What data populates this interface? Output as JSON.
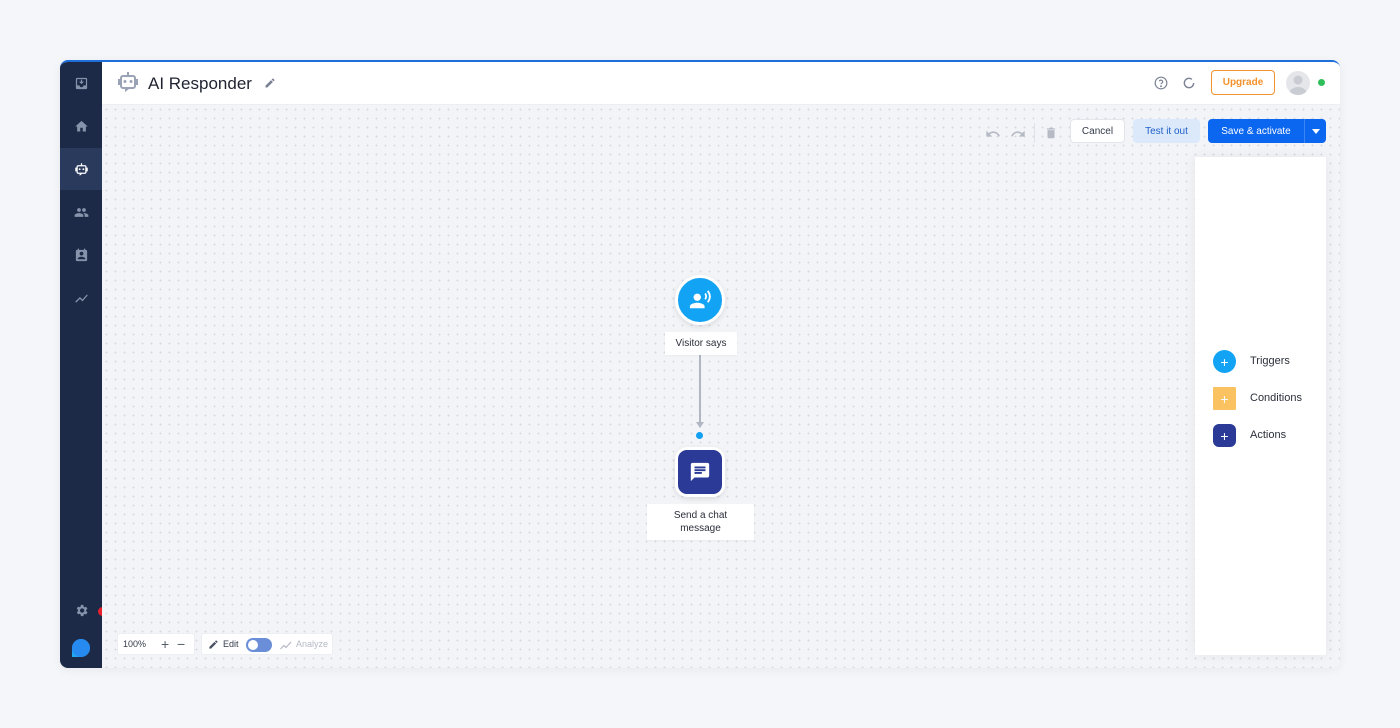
{
  "app": {
    "title": "AI Responder",
    "accent_color": "#0b66f0",
    "sidebar_color": "#1c2a47"
  },
  "sidebar": {
    "items": [
      {
        "icon": "inbox-icon",
        "active": false
      },
      {
        "icon": "home-icon",
        "active": false
      },
      {
        "icon": "bot-icon",
        "active": true
      },
      {
        "icon": "people-icon",
        "active": false
      },
      {
        "icon": "contacts-icon",
        "active": false
      },
      {
        "icon": "analytics-icon",
        "active": false
      }
    ],
    "bottom": {
      "settings_icon": "gear-icon",
      "notification": true,
      "logo_icon": "brand-logo"
    }
  },
  "header": {
    "upgrade_label": "Upgrade",
    "help_icon": "help-icon",
    "sync_icon": "sync-icon",
    "online_status_color": "#2fbf5a"
  },
  "toolbar": {
    "cancel_label": "Cancel",
    "test_label": "Test it out",
    "save_label": "Save & activate"
  },
  "flow": {
    "nodes": [
      {
        "type": "trigger",
        "label": "Visitor says",
        "color": "#12a3f5",
        "icon": "visitor-speaking-icon"
      },
      {
        "type": "action",
        "label": "Send a chat message",
        "color": "#2a3a96",
        "icon": "chat-message-icon"
      }
    ]
  },
  "panel": {
    "items": [
      {
        "label": "Triggers",
        "color": "#12a3f5",
        "shape": "circle"
      },
      {
        "label": "Conditions",
        "color": "#fbc262",
        "shape": "square"
      },
      {
        "label": "Actions",
        "color": "#2a3a96",
        "shape": "rounded"
      }
    ]
  },
  "bottom_bar": {
    "zoom": "100%",
    "zoom_in": "+",
    "zoom_out": "−",
    "edit_label": "Edit",
    "analyze_label": "Analyze"
  }
}
